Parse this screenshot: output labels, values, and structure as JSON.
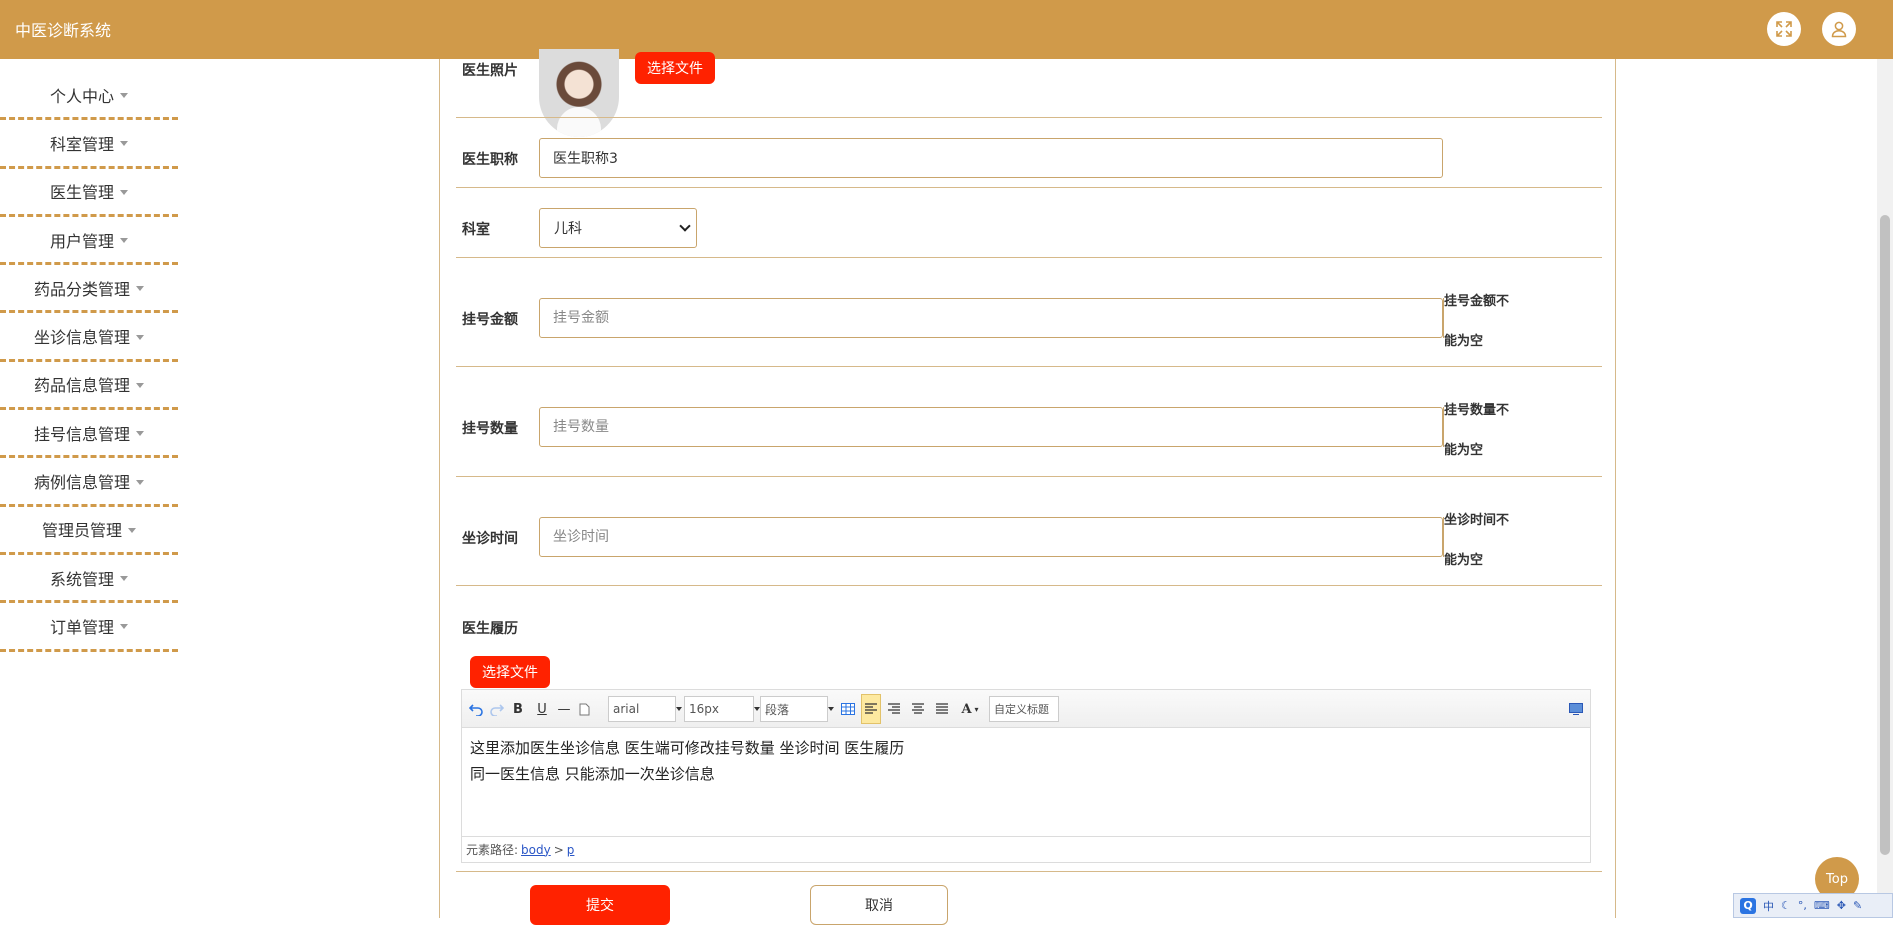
{
  "app": {
    "title": "中医诊断系统"
  },
  "header": {
    "fullscreen_icon": "expand-icon",
    "user_icon": "user-icon"
  },
  "sidebar": {
    "items": [
      {
        "label": "个人中心"
      },
      {
        "label": "科室管理"
      },
      {
        "label": "医生管理"
      },
      {
        "label": "用户管理"
      },
      {
        "label": "药品分类管理"
      },
      {
        "label": "坐诊信息管理"
      },
      {
        "label": "药品信息管理"
      },
      {
        "label": "挂号信息管理"
      },
      {
        "label": "病例信息管理"
      },
      {
        "label": "管理员管理"
      },
      {
        "label": "系统管理"
      },
      {
        "label": "订单管理"
      }
    ]
  },
  "form": {
    "photo": {
      "label": "医生照片",
      "button": "选择文件"
    },
    "title": {
      "label": "医生职称",
      "value": "医生职称3"
    },
    "department": {
      "label": "科室",
      "value": "儿科"
    },
    "fee": {
      "label": "挂号金额",
      "placeholder": "挂号金额",
      "error_line1": "挂号金额不",
      "error_line2": "能为空"
    },
    "count": {
      "label": "挂号数量",
      "placeholder": "挂号数量",
      "error_line1": "挂号数量不",
      "error_line2": "能为空"
    },
    "time": {
      "label": "坐诊时间",
      "placeholder": "坐诊时间",
      "error_line1": "坐诊时间不",
      "error_line2": "能为空"
    },
    "resume": {
      "label": "医生履历",
      "button": "选择文件",
      "toolbar": {
        "font": "arial",
        "size": "16px",
        "paragraph": "段落",
        "custom_title": "自定义标题"
      },
      "content_line1": "这里添加医生坐诊信息 医生端可修改挂号数量 坐诊时间 医生履历",
      "content_line2": "同一医生信息 只能添加一次坐诊信息",
      "path_label": "元素路径:",
      "path_body": "body",
      "path_sep": ">",
      "path_p": "p"
    },
    "submit": "提交",
    "cancel": "取消"
  },
  "top_button": "Top",
  "ime": {
    "logo": "Q",
    "mode": "中"
  },
  "colors": {
    "header": "#d09a4a",
    "accent_red": "#ff2200",
    "border": "#c9a56c"
  }
}
